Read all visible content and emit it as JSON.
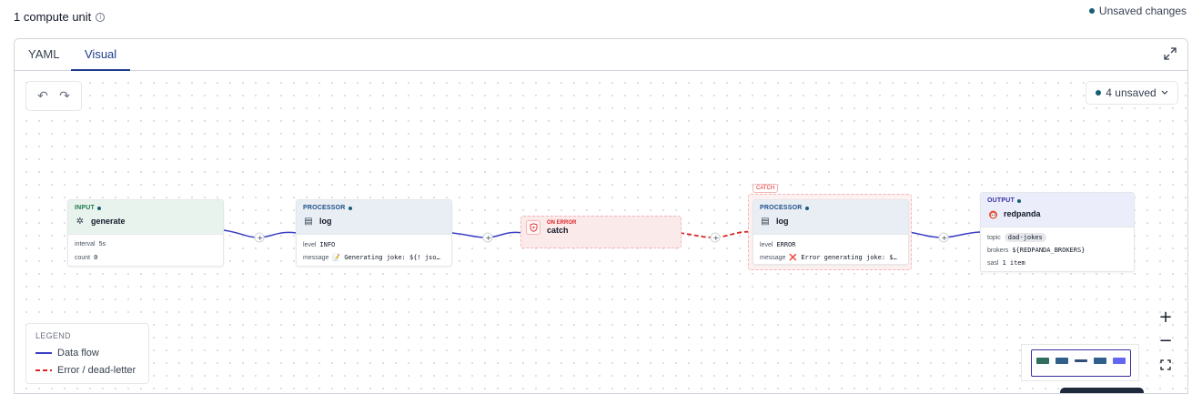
{
  "header": {
    "compute_units": "1 compute unit",
    "unsaved_changes": "Unsaved changes"
  },
  "tabs": [
    {
      "label": "YAML",
      "active": false
    },
    {
      "label": "Visual",
      "active": true
    }
  ],
  "toolbar": {
    "undo_icon": "undo-icon",
    "redo_icon": "redo-icon",
    "unsaved_button": "4 unsaved"
  },
  "nodes": {
    "input": {
      "kind": "INPUT",
      "name": "generate",
      "icon": "sparkle-icon",
      "rows": [
        {
          "key": "interval",
          "value": "5s"
        },
        {
          "key": "count",
          "value": "0"
        }
      ]
    },
    "processor1": {
      "kind": "PROCESSOR",
      "name": "log",
      "icon": "log-icon",
      "rows": [
        {
          "key": "level",
          "value": "INFO"
        },
        {
          "key": "message",
          "value": "📝 Generating joke: ${! jso…"
        }
      ]
    },
    "on_error": {
      "kind": "ON ERROR",
      "name": "catch",
      "icon": "shield-icon"
    },
    "catch_group": {
      "label": "CATCH"
    },
    "processor2": {
      "kind": "PROCESSOR",
      "name": "log",
      "icon": "log-icon",
      "rows": [
        {
          "key": "level",
          "value": "ERROR"
        },
        {
          "key": "message",
          "value": "❌ Error generating joke: $…"
        }
      ]
    },
    "output": {
      "kind": "OUTPUT",
      "name": "redpanda",
      "icon": "redpanda-icon",
      "rows": [
        {
          "key": "topic",
          "value": "dad-jokes"
        },
        {
          "key": "brokers",
          "value": "${REDPANDA_BROKERS}"
        },
        {
          "key": "sasl",
          "value": "1 item"
        }
      ]
    }
  },
  "legend": {
    "title": "LEGEND",
    "items": [
      {
        "label": "Data flow",
        "style": "solid",
        "color": "#3b3fc4"
      },
      {
        "label": "Error / dead-letter",
        "style": "dashed",
        "color": "#dc2626"
      }
    ]
  },
  "colors": {
    "accent": "#1e3a8a",
    "status_dot": "#155e75",
    "input_head": "#e8f3ee",
    "processor_head": "#e8eef3",
    "output_head": "#ecedfb",
    "error_bg": "#fbeaea",
    "flow_edge": "#3b3fc4",
    "error_edge": "#dc2626"
  }
}
